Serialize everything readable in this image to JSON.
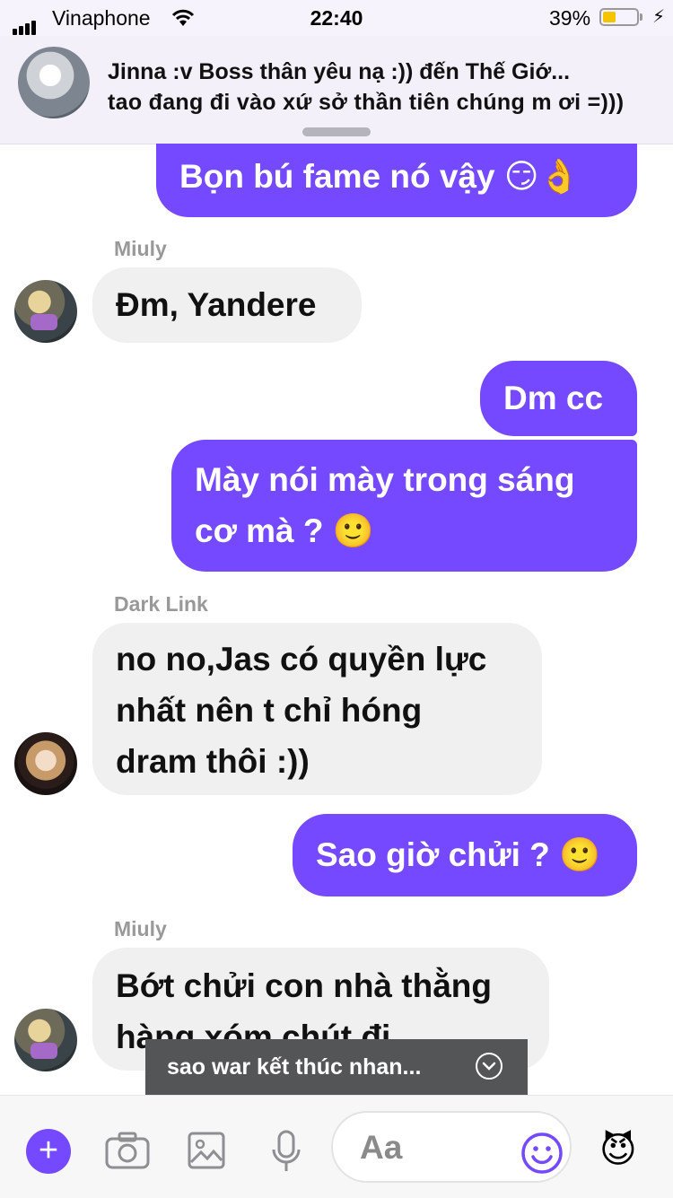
{
  "status_bar": {
    "carrier": "Vinaphone",
    "time": "22:40",
    "battery_percent": "39%",
    "battery_level": 0.39
  },
  "notification": {
    "title": "Jinna :v Boss thân yêu nạ :)) đến Thế Giớ...",
    "body": "tao đang đi vào xứ sở thần tiên chúng m ơi =)))"
  },
  "messages": {
    "m1": {
      "text": "Bọn bú fame nó vậy",
      "emoji": "😏👌"
    },
    "m2_name": "Miuly",
    "m2": {
      "text": "Đm, Yandere"
    },
    "m3": {
      "text": "Dm cc"
    },
    "m4": {
      "line1": "Mày nói mày trong sáng",
      "line2": "cơ mà ?",
      "emoji": "🙂"
    },
    "m5_name": "Dark Link",
    "m5": {
      "line1": "no no,Jas có quyền lực",
      "line2": "nhất nên t chỉ hóng",
      "line3": "dram thôi :))"
    },
    "m6": {
      "text": "Sao giờ chửi ?",
      "emoji": "🙂"
    },
    "m7_name": "Miuly",
    "m7": {
      "line1": "Bớt chửi con nhà thằng",
      "line2": "hàng xóm chút đi"
    }
  },
  "toast": {
    "text": "sao war kết thúc nhan..."
  },
  "composer": {
    "placeholder": "Aa",
    "quick_reaction": "😈",
    "icons": [
      "plus-icon",
      "camera-icon",
      "image-icon",
      "microphone-icon",
      "smiley-icon"
    ]
  },
  "colors": {
    "accent": "#7449ff",
    "incoming_bubble": "#f1f0f0",
    "toast_bg": "#545556"
  }
}
